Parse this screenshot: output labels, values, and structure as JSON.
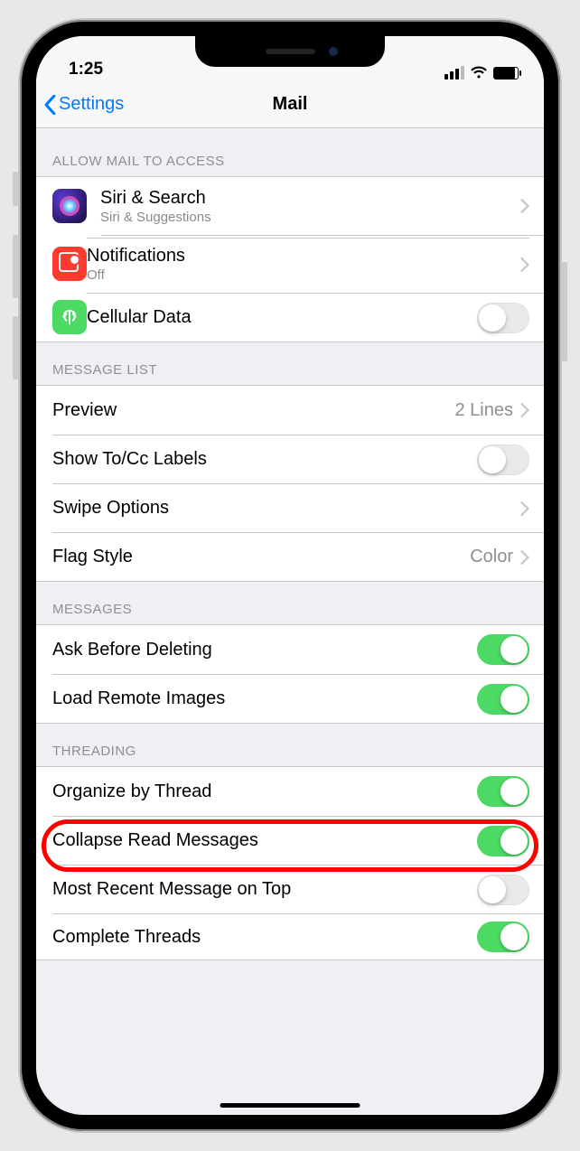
{
  "status": {
    "time": "1:25"
  },
  "nav": {
    "back_label": "Settings",
    "title": "Mail"
  },
  "sections": {
    "access": {
      "header": "Allow Mail to Access",
      "siri_title": "Siri & Search",
      "siri_sub": "Siri & Suggestions",
      "notif_title": "Notifications",
      "notif_sub": "Off",
      "cell_title": "Cellular Data",
      "cell_on": false
    },
    "message_list": {
      "header": "Message List",
      "preview_label": "Preview",
      "preview_value": "2 Lines",
      "showtocc_label": "Show To/Cc Labels",
      "showtocc_on": false,
      "swipe_label": "Swipe Options",
      "flag_label": "Flag Style",
      "flag_value": "Color"
    },
    "messages": {
      "header": "Messages",
      "ask_label": "Ask Before Deleting",
      "ask_on": true,
      "load_label": "Load Remote Images",
      "load_on": true
    },
    "threading": {
      "header": "Threading",
      "organize_label": "Organize by Thread",
      "organize_on": true,
      "collapse_label": "Collapse Read Messages",
      "collapse_on": true,
      "recent_label": "Most Recent Message on Top",
      "recent_on": false,
      "complete_label": "Complete Threads",
      "complete_on": true
    }
  }
}
